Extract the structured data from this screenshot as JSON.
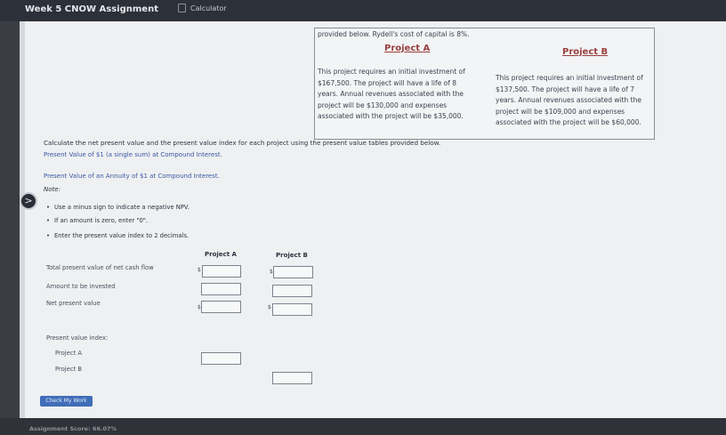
{
  "app": {
    "title": "Week 5 CNOW Assignment",
    "calculator_label": "Calculator"
  },
  "problem": {
    "intro": "provided below. Rydell's cost of capital is 8%.",
    "project_a": {
      "heading": "Project A",
      "lines": [
        "This project requires an initial investment of",
        "$167,500. The project will have a life of 8",
        "years. Annual revenues associated with the",
        "project will be $130,000 and expenses",
        "associated with the project will be $35,000."
      ]
    },
    "project_b": {
      "heading": "Project B",
      "lines": [
        "This project requires an initial investment of",
        "$137,500. The project will have a life of 7",
        "years. Annual revenues associated with the",
        "project will be $109,000 and expenses",
        "associated with the project will be $60,000."
      ]
    }
  },
  "instructions": {
    "main": "Calculate the net present value and the present value index for each project using the present value tables provided below.",
    "link1": "Present Value of $1 (a single sum) at Compound Interest.",
    "link2": "Present Value of an Annuity of $1 at Compound Interest.",
    "note_label": "Note:",
    "bullets": [
      "Use a minus sign to indicate a negative NPV.",
      "If an amount is zero, enter \"0\".",
      "Enter the present value index to 2 decimals."
    ]
  },
  "table": {
    "col_a": "Project A",
    "col_b": "Project B",
    "rows": {
      "total_pv": "Total present value of net cash flow",
      "invested": "Amount to be invested",
      "npv": "Net present value"
    },
    "currency": "$",
    "pvi_heading": "Present value index:",
    "pvi_a": "Project A",
    "pvi_b": "Project B"
  },
  "inputs": {
    "total_pv_a": "",
    "total_pv_b": "",
    "invested_a": "",
    "invested_b": "",
    "npv_a": "",
    "npv_b": "",
    "pvi_a": "",
    "pvi_b": ""
  },
  "buttons": {
    "check": "Check My Work",
    "expand": ">"
  },
  "footer": {
    "score": "Assignment Score: 66.07%"
  }
}
